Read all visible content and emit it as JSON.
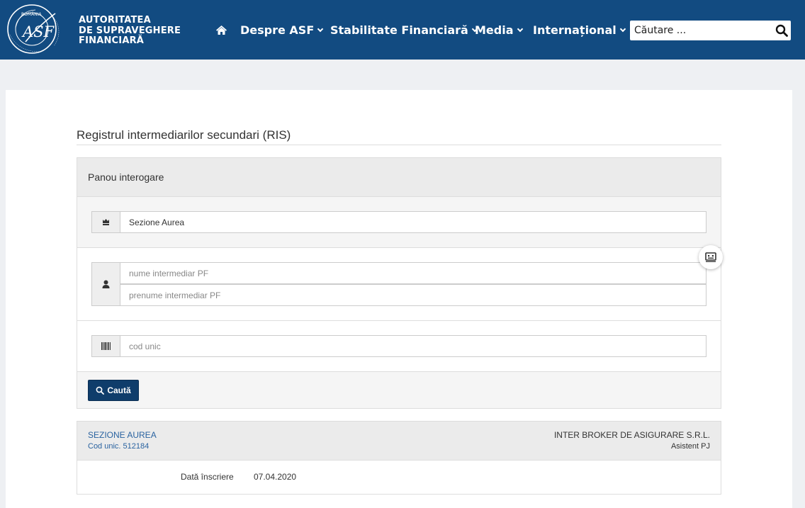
{
  "header": {
    "seal_text": "ROMÂNIA · AUTORITATEA DE SUPRAVEGHERE FINANCIARĂ",
    "seal_monogram": "ASF",
    "logo_lines": [
      "AUTORITATEA",
      "DE SUPRAVEGHERE",
      "FINANCIARĂ"
    ],
    "home_icon": "home-icon",
    "nav": [
      {
        "label": "Despre ASF"
      },
      {
        "label": "Stabilitate Financiară"
      },
      {
        "label": "Media"
      },
      {
        "label": "Internațional"
      }
    ],
    "search_placeholder": "Căutare ...",
    "colors": {
      "bar": "#124b81"
    }
  },
  "page": {
    "title": "Registrul intermediarilor secundari (RIS)"
  },
  "query_panel": {
    "heading": "Panou interogare",
    "company_icon": "building-icon",
    "company_value": "Sezione Aurea",
    "person_icon": "user-icon",
    "last_name_placeholder": "nume intermediar PF",
    "first_name_placeholder": "prenume intermediar PF",
    "code_icon": "barcode-icon",
    "code_placeholder": "cod unic",
    "search_button_label": "Caută",
    "search_button_icon": "search-icon"
  },
  "side_widget": {
    "icon": "id-card-icon"
  },
  "result": {
    "name": "SEZIONE AUREA",
    "code_label": "Cod unic.",
    "code_value": "512184",
    "company": "INTER BROKER DE ASIGURARE S.R.L.",
    "type": "Asistent PJ",
    "date_label": "Dată înscriere",
    "date_value": "07.04.2020"
  }
}
